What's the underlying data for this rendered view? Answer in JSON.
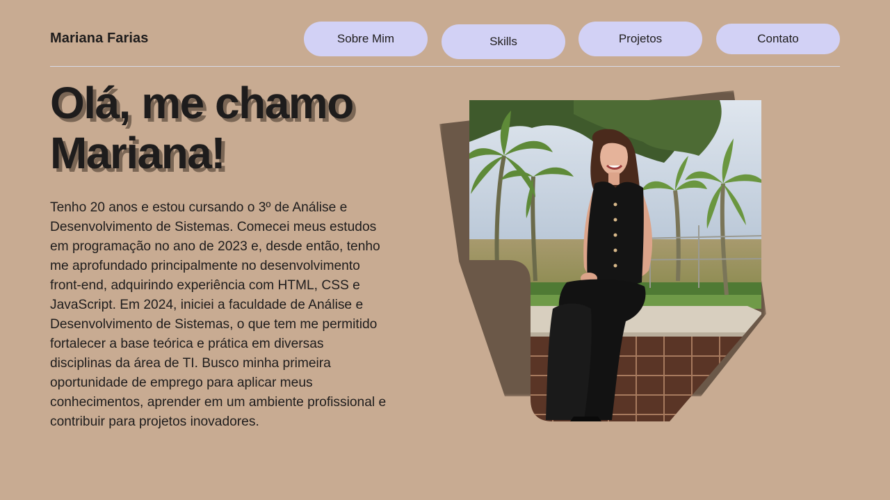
{
  "header": {
    "brand": "Mariana Farias",
    "nav": [
      {
        "label": "Sobre Mim"
      },
      {
        "label": "Skills"
      },
      {
        "label": "Projetos"
      },
      {
        "label": "Contato"
      }
    ]
  },
  "hero": {
    "title": "Olá, me chamo Mariana!",
    "bio": "Tenho 20 anos e estou cursando o 3º de Análise e Desenvolvimento de Sistemas.  Comecei meus estudos em programação no ano de 2023 e, desde então, tenho me aprofundado principalmente no desenvolvimento front-end, adquirindo experiência com HTML, CSS e JavaScript. Em 2024, iniciei a faculdade de Análise e Desenvolvimento de Sistemas, o que tem me permitido fortalecer a base teórica e prática em diversas disciplinas da área de TI. Busco minha primeira oportunidade de emprego para aplicar meus conhecimentos, aprender em um ambiente profissional e contribuir para projetos inovadores."
  },
  "colors": {
    "background": "#c8ab92",
    "nav_button": "#d2d1f5",
    "text": "#1e1c1c",
    "title_shadow": "#7a6655",
    "divider": "#d9dce8"
  }
}
